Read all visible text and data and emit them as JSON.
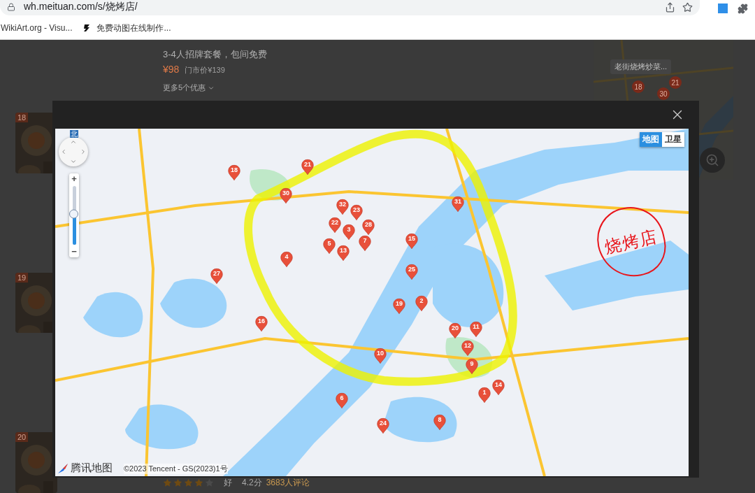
{
  "browser": {
    "url": "wh.meituan.com/s/烧烤店/",
    "bookmarks": [
      {
        "title": "WikiArt.org - Visu..."
      },
      {
        "title": "免费动图在线制作..."
      }
    ]
  },
  "page": {
    "deal": {
      "title": "3-4人招牌套餐，包间免费",
      "price": "¥98",
      "original_price": "门市价¥139",
      "more": "更多5个优惠"
    },
    "results": [
      {
        "rank": "18"
      },
      {
        "rank": "19"
      },
      {
        "rank": "20"
      }
    ],
    "mini_map": {
      "tooltip": "老街烧烤炒菜...",
      "pins": [
        {
          "label": "18"
        },
        {
          "label": "21"
        },
        {
          "label": "30"
        }
      ]
    },
    "rating": {
      "stars": 4,
      "grade": "好",
      "score": "4.2分",
      "reviews": "3683人评论"
    }
  },
  "map_dialog": {
    "map_types": [
      {
        "label": "地图",
        "selected": true
      },
      {
        "label": "卫星",
        "selected": false
      }
    ],
    "compass": "北",
    "zoom": {
      "plus": "+",
      "minus": "−",
      "level": 0.52
    },
    "pins": [
      {
        "label": "18"
      },
      {
        "label": "21"
      },
      {
        "label": "30"
      },
      {
        "label": "32"
      },
      {
        "label": "23"
      },
      {
        "label": "22"
      },
      {
        "label": "3"
      },
      {
        "label": "28"
      },
      {
        "label": "5"
      },
      {
        "label": "13"
      },
      {
        "label": "7"
      },
      {
        "label": "4"
      },
      {
        "label": "27"
      },
      {
        "label": "31"
      },
      {
        "label": "15"
      },
      {
        "label": "25"
      },
      {
        "label": "19"
      },
      {
        "label": "2"
      },
      {
        "label": "16"
      },
      {
        "label": "20"
      },
      {
        "label": "11"
      },
      {
        "label": "12"
      },
      {
        "label": "9"
      },
      {
        "label": "10"
      },
      {
        "label": "14"
      },
      {
        "label": "1"
      },
      {
        "label": "6"
      },
      {
        "label": "24"
      },
      {
        "label": "8"
      }
    ],
    "annotation": "烧烤店",
    "logo": "腾讯地图",
    "copyright": "©2023 Tencent - GS(2023)1号"
  }
}
